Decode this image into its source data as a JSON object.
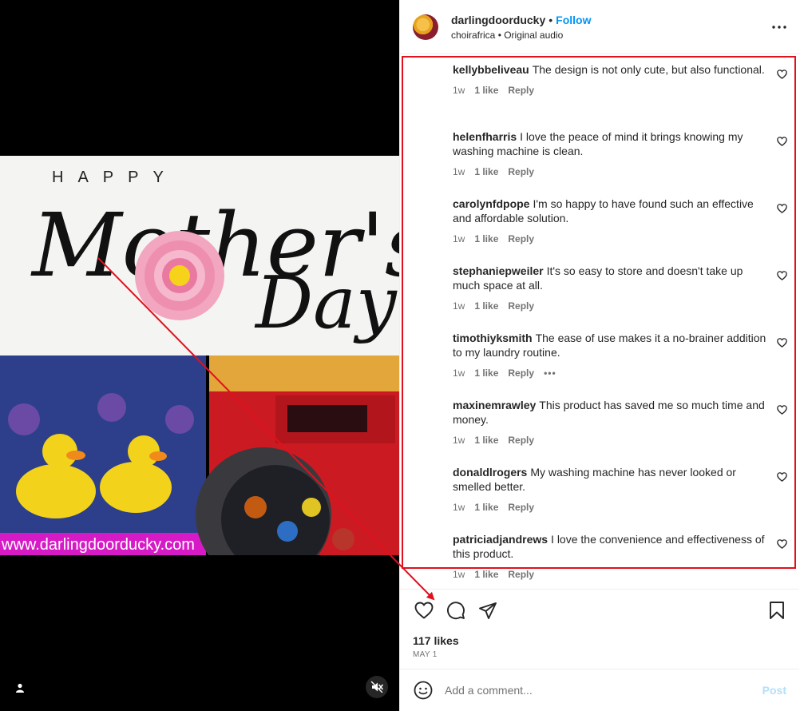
{
  "media": {
    "image_text_happy": "HAPPY",
    "image_text_mothers": "Mother's",
    "image_text_day": "Day",
    "image_text_url": "www.darlingdoorducky.com"
  },
  "post": {
    "username": "darlingdoorducky",
    "separator": "•",
    "follow_label": "Follow",
    "audio_line": "choirafrica • Original audio"
  },
  "comments": [
    {
      "user": "kellybbeliveau",
      "text": "The design is not only cute, but also functional.",
      "age": "1w",
      "likes": "1 like",
      "reply": "Reply",
      "avatar_color": "#c9c4bd",
      "more": ""
    },
    {
      "user": "helenfharris",
      "text": "I love the peace of mind it brings knowing my washing machine is clean.",
      "age": "1w",
      "likes": "1 like",
      "reply": "Reply",
      "avatar_color": "#c24a55",
      "more": ""
    },
    {
      "user": "carolynfdpope",
      "text": "I'm so happy to have found such an effective and affordable solution.",
      "age": "1w",
      "likes": "1 like",
      "reply": "Reply",
      "avatar_color": "#b58a78",
      "more": ""
    },
    {
      "user": "stephaniepweiler",
      "text": "It's so easy to store and doesn't take up much space at all.",
      "age": "1w",
      "likes": "1 like",
      "reply": "Reply",
      "avatar_color": "#8c6a5e",
      "more": ""
    },
    {
      "user": "timothiyksmith",
      "text": "The ease of use makes it a no-brainer addition to my laundry routine.",
      "age": "1w",
      "likes": "1 like",
      "reply": "Reply",
      "avatar_color": "#7a4a2e",
      "more": "•••"
    },
    {
      "user": "maxinemrawley",
      "text": "This product has saved me so much time and money.",
      "age": "1w",
      "likes": "1 like",
      "reply": "Reply",
      "avatar_color": "#d98fa0",
      "more": ""
    },
    {
      "user": "donaldlrogers",
      "text": "My washing machine has never looked or smelled better.",
      "age": "1w",
      "likes": "1 like",
      "reply": "Reply",
      "avatar_color": "#6f5a4a",
      "more": ""
    },
    {
      "user": "patriciadjandrews",
      "text": "I love the convenience and effectiveness of this product.",
      "age": "1w",
      "likes": "1 like",
      "reply": "Reply",
      "avatar_color": "#a9a59c",
      "more": ""
    }
  ],
  "footer": {
    "likes": "117 likes",
    "date": "MAY 1",
    "comment_placeholder": "Add a comment...",
    "post_label": "Post"
  },
  "colors": {
    "highlight": "#e0111d",
    "link": "#0095f6"
  },
  "icons": [
    "user-tag-icon",
    "mute-icon",
    "more-icon",
    "heart-icon",
    "comment-icon",
    "share-icon",
    "bookmark-icon",
    "emoji-icon"
  ]
}
